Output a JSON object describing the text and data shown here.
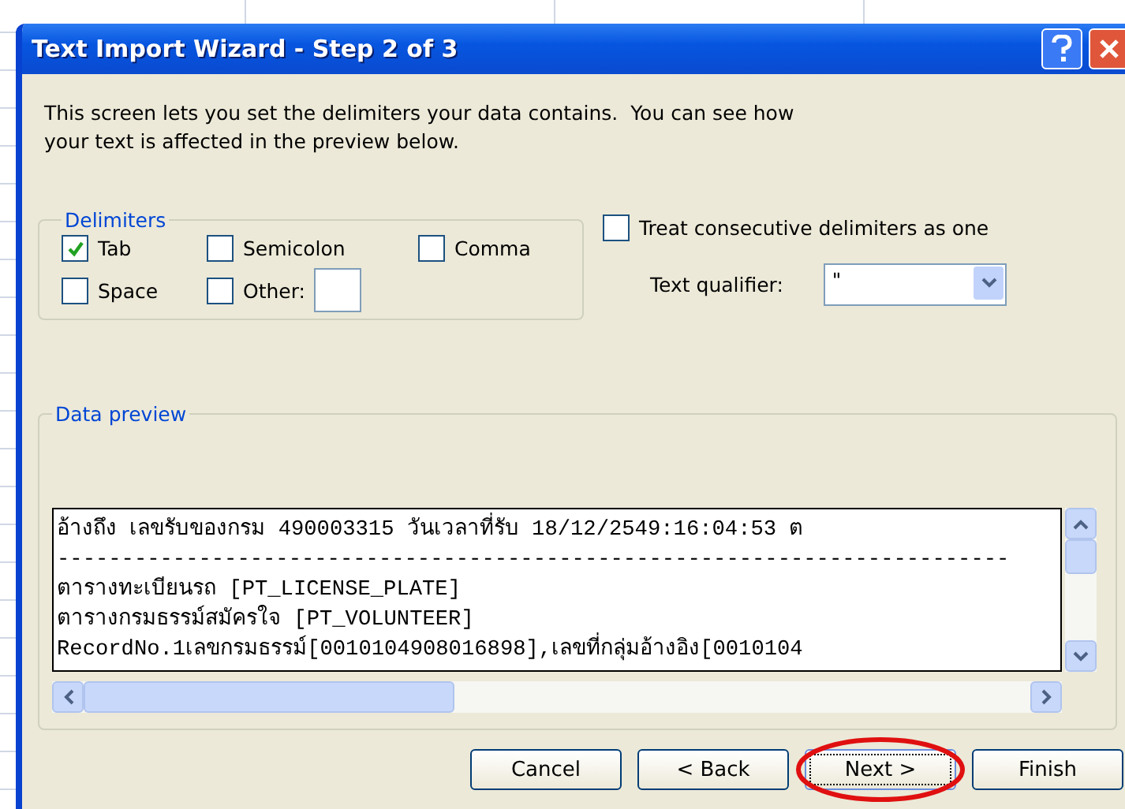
{
  "window": {
    "title": "Text Import Wizard - Step 2 of 3"
  },
  "intro": "This screen lets you set the delimiters your data contains.  You can see how your text is affected in the preview below.",
  "delimiters": {
    "title": "Delimiters",
    "options": [
      {
        "label": "Tab",
        "checked": true
      },
      {
        "label": "Semicolon",
        "checked": false
      },
      {
        "label": "Comma",
        "checked": false
      },
      {
        "label": "Space",
        "checked": false
      },
      {
        "label": "Other:",
        "checked": false
      }
    ]
  },
  "consecutive": {
    "label": "Treat consecutive delimiters as one",
    "checked": false
  },
  "text_qualifier": {
    "label": "Text qualifier:",
    "value": "\""
  },
  "data_preview": {
    "title": "Data preview",
    "lines": [
      "อ้างถึง เลขรับของกรม 490003315 วันเวลาที่รับ 18/12/2549:16:04:53 ต",
      "--------------------------------------------------------------------------",
      "ตารางทะเบียนรถ [PT_LICENSE_PLATE]",
      "ตารางกรมธรรม์สมัครใจ [PT_VOLUNTEER]",
      "RecordNo.1เลขกรมธรรม์[0010104908016898],เลขที่กลุ่มอ้างอิง[0010104"
    ]
  },
  "buttons": [
    {
      "label": "Cancel",
      "highlighted": false
    },
    {
      "label": "< Back",
      "highlighted": false
    },
    {
      "label": "Next >",
      "highlighted": true
    },
    {
      "label": "Finish",
      "highlighted": false
    }
  ]
}
